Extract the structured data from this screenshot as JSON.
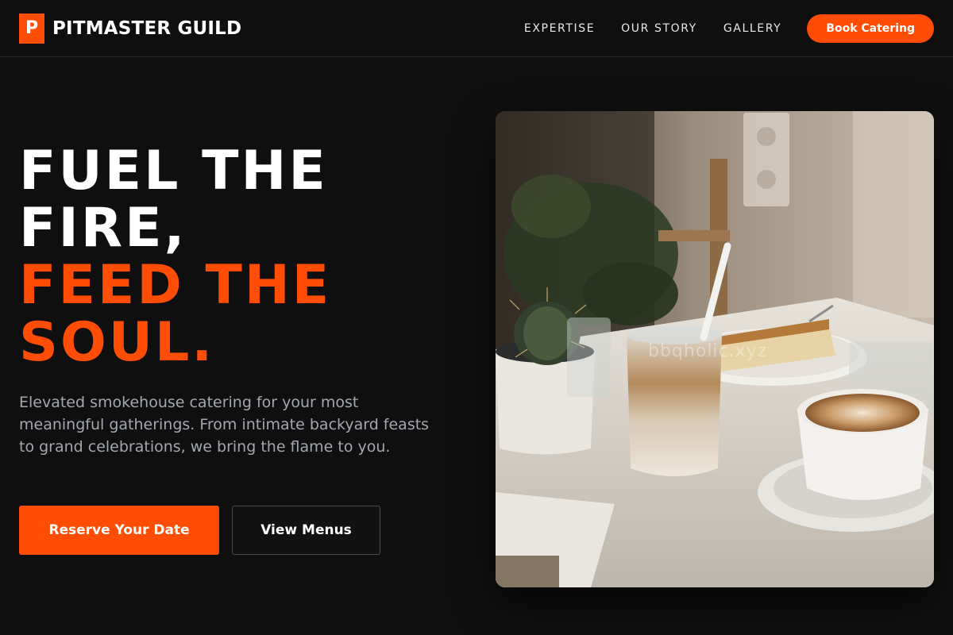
{
  "brand": {
    "mark": "P",
    "name": "PITMASTER GUILD",
    "accent_color": "#ff4d06"
  },
  "nav": {
    "links": [
      "EXPERTISE",
      "OUR STORY",
      "GALLERY"
    ],
    "cta_label": "Book Catering"
  },
  "hero": {
    "headline_lines": [
      "FUEL THE",
      "FIRE,"
    ],
    "headline_accent_lines": [
      "FEED THE",
      "SOUL."
    ],
    "subtext": "Elevated smokehouse catering for your most meaningful gatherings. From intimate backyard feasts to grand celebrations, we bring the flame to you.",
    "primary_button": "Reserve Your Date",
    "secondary_button": "View Menus"
  },
  "image": {
    "subject": "cafe table with coffee, cheesecake, iced latte and cactus",
    "watermark": "bbqholic.xyz"
  },
  "colors": {
    "background": "#0f0f0f",
    "accent": "#ff4d06",
    "muted_text": "#a3a7b0"
  }
}
